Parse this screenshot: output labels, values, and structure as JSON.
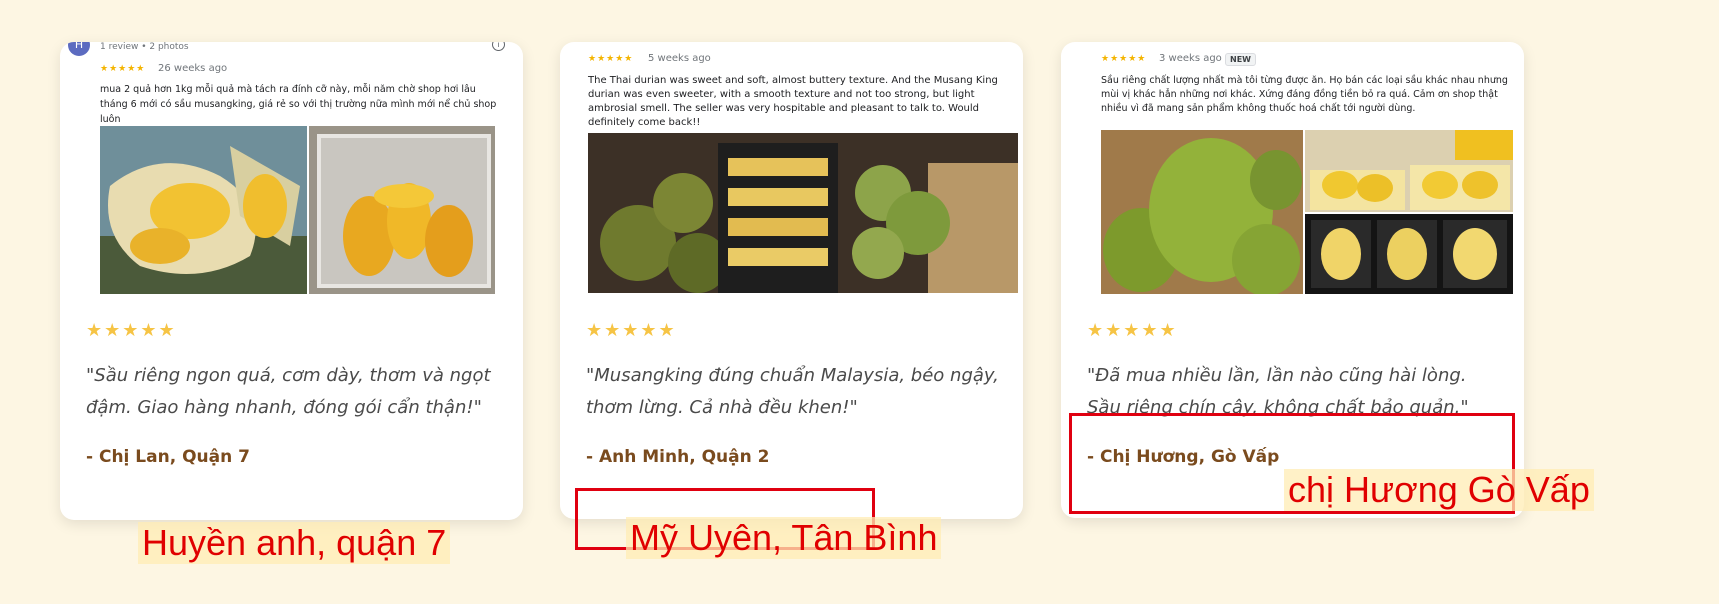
{
  "cards": [
    {
      "mini_meta": "1 review • 2 photos",
      "mini_stars": "★★★★★",
      "mini_time": "26 weeks ago",
      "mini_text": "mua 2 quả hơn 1kg mỗi quả mà tách ra đính cỡ này, mỗi năm chờ shop hơi lâu tháng 6 mới có sầu musangking, giá rẻ so với thị trường nữa mình mới nể chủ shop luôn",
      "avatar_letter": "H",
      "stars": "★★★★★",
      "quote": "\"Sầu riêng ngon quá, cơm dày, thơm và ngọt đậm. Giao hàng nhanh, đóng gói cẩn thận!\"",
      "author": "- Chị Lan, Quận 7"
    },
    {
      "mini_stars": "★★★★★",
      "mini_time": "5 weeks ago",
      "mini_text": "The Thai durian was sweet and soft, almost buttery texture. And the Musang King durian was even sweeter, with a smooth texture and not too strong, but light ambrosial smell. The seller was very hospitable and pleasant to talk to. Would definitely come back!!",
      "stars": "★★★★★",
      "quote": "\"Musangking đúng chuẩn Malaysia, béo ngậy, thơm lừng. Cả nhà đều khen!\"",
      "author": "- Anh Minh, Quận 2"
    },
    {
      "mini_stars": "★★★★★",
      "mini_time": "3 weeks ago",
      "mini_badge": "NEW",
      "mini_text": "Sầu riêng chất lượng nhất mà tôi từng được ăn. Họ bán các loại sầu khác nhau nhưng mùi vị khác hẳn những nơi khác. Xứng đáng đồng tiền bỏ ra quá. Cảm ơn shop thật nhiều vì đã mang sản phẩm không thuốc hoá chất tới người dùng.",
      "stars": "★★★★★",
      "quote": "\"Đã mua nhiều lần, lần nào cũng hài lòng. Sầu riêng chín cây, không chất bảo quản.\"",
      "author": "- Chị Hương, Gò Vấp"
    }
  ],
  "annotations": {
    "a1": "Huyền anh, quận 7",
    "a2": "Mỹ Uyên, Tân Bình",
    "a3": "chị Hương Gò Vấp"
  },
  "colors": {
    "background": "#fdf6e3",
    "star": "#f6c445",
    "author": "#7a4b1e",
    "annotation": "#e00000"
  }
}
